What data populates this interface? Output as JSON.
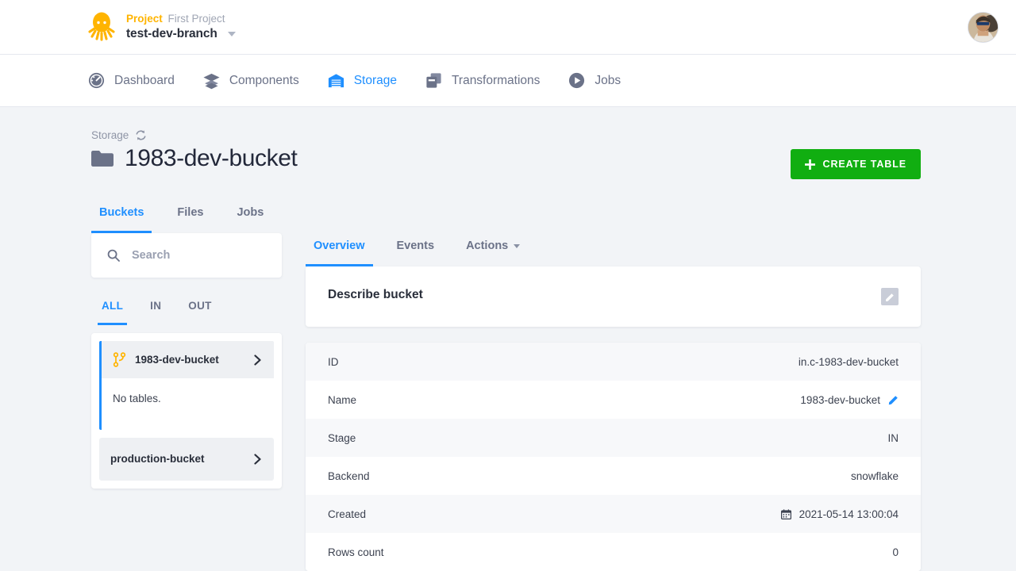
{
  "topbar": {
    "project_label": "Project",
    "project_name": "First Project",
    "branch_name": "test-dev-branch",
    "logo_name": "keboola-octopus-logo",
    "avatar_name": "user-avatar"
  },
  "nav": {
    "items": [
      {
        "label": "Dashboard",
        "icon": "gauge-icon",
        "active": false
      },
      {
        "label": "Components",
        "icon": "layers-icon",
        "active": false
      },
      {
        "label": "Storage",
        "icon": "warehouse-icon",
        "active": true
      },
      {
        "label": "Transformations",
        "icon": "copy-squares-icon",
        "active": false
      },
      {
        "label": "Jobs",
        "icon": "play-circle-icon",
        "active": false
      }
    ]
  },
  "breadcrumb": {
    "root": "Storage"
  },
  "header": {
    "title": "1983-dev-bucket",
    "create_button": "CREATE TABLE"
  },
  "tabs": [
    {
      "label": "Buckets",
      "active": true
    },
    {
      "label": "Files",
      "active": false
    },
    {
      "label": "Jobs",
      "active": false
    }
  ],
  "sidebar": {
    "search_placeholder": "Search",
    "search_value": "",
    "filters": [
      {
        "label": "ALL",
        "active": true
      },
      {
        "label": "IN",
        "active": false
      },
      {
        "label": "OUT",
        "active": false
      }
    ],
    "buckets": [
      {
        "name": "1983-dev-bucket",
        "selected": true,
        "empty_text": "No tables."
      },
      {
        "name": "production-bucket",
        "selected": false
      }
    ]
  },
  "detail": {
    "tabs": [
      {
        "label": "Overview",
        "active": true,
        "caret": false
      },
      {
        "label": "Events",
        "active": false,
        "caret": false
      },
      {
        "label": "Actions",
        "active": false,
        "caret": true
      }
    ],
    "describe_panel": {
      "title": "Describe bucket"
    },
    "rows": [
      {
        "key": "ID",
        "value": "in.c-1983-dev-bucket",
        "edit": false,
        "calendar": false
      },
      {
        "key": "Name",
        "value": "1983-dev-bucket",
        "edit": true,
        "calendar": false
      },
      {
        "key": "Stage",
        "value": "IN",
        "edit": false,
        "calendar": false
      },
      {
        "key": "Backend",
        "value": "snowflake",
        "edit": false,
        "calendar": false
      },
      {
        "key": "Created",
        "value": "2021-05-14 13:00:04",
        "edit": false,
        "calendar": true
      },
      {
        "key": "Rows count",
        "value": "0",
        "edit": false,
        "calendar": false
      }
    ]
  },
  "colors": {
    "accent_blue": "#1f8fff",
    "brand_orange": "#ffb400",
    "success_green": "#11ae11",
    "page_bg": "#f2f4f7",
    "text_dark": "#2a2f3b",
    "text_muted": "#6b7288"
  }
}
